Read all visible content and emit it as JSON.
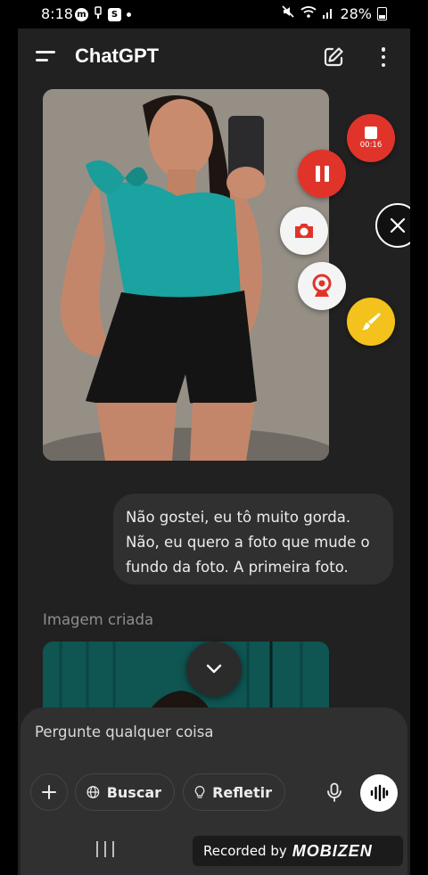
{
  "status_bar": {
    "time": "8:18",
    "battery": "28%",
    "left_icons": [
      "mobizen-icon",
      "usb-icon",
      "s-app-icon",
      "dot-icon"
    ],
    "right_icons": [
      "mute-icon",
      "wifi-icon",
      "signal-icon",
      "battery-icon"
    ]
  },
  "header": {
    "title": "ChatGPT",
    "icons": {
      "menu": "menu-icon",
      "new_chat": "edit-icon",
      "more": "more-vertical-icon"
    }
  },
  "conversation": {
    "first_image": {
      "kind": "generated-photo",
      "subject": "woman in teal one-shoulder top and black shorts taking a mirror selfie"
    },
    "user_message": {
      "line1": "Não gostei, eu tô muito gorda.",
      "line2": "Não, eu quero a foto que mude o",
      "line3": "fundo da foto. A primeira foto."
    },
    "image_caption": "Imagem criada",
    "second_image": {
      "kind": "generated-photo",
      "subject": "woman against teal curtain background (partially visible)"
    }
  },
  "scroll_button": {
    "icon": "chevron-down-icon"
  },
  "composer": {
    "placeholder": "Pergunte qualquer coisa",
    "add_icon": "plus-icon",
    "search_label": "Buscar",
    "think_label": "Refletir",
    "mic_icon": "microphone-icon",
    "voice_icon": "voice-waveform-icon"
  },
  "recorder_overlay": {
    "elapsed": "00:16",
    "buttons": [
      "stop-icon",
      "pause-icon",
      "camera-icon",
      "webcam-icon",
      "close-icon",
      "brush-icon"
    ],
    "stop_color": "#e0342b",
    "brush_color": "#f3c21c"
  },
  "watermark": {
    "prefix": "Recorded by",
    "brand": "MOBIZEN"
  },
  "colors": {
    "app_bg": "#212121",
    "bubble_bg": "#303030",
    "caption": "#8e8e8e"
  }
}
